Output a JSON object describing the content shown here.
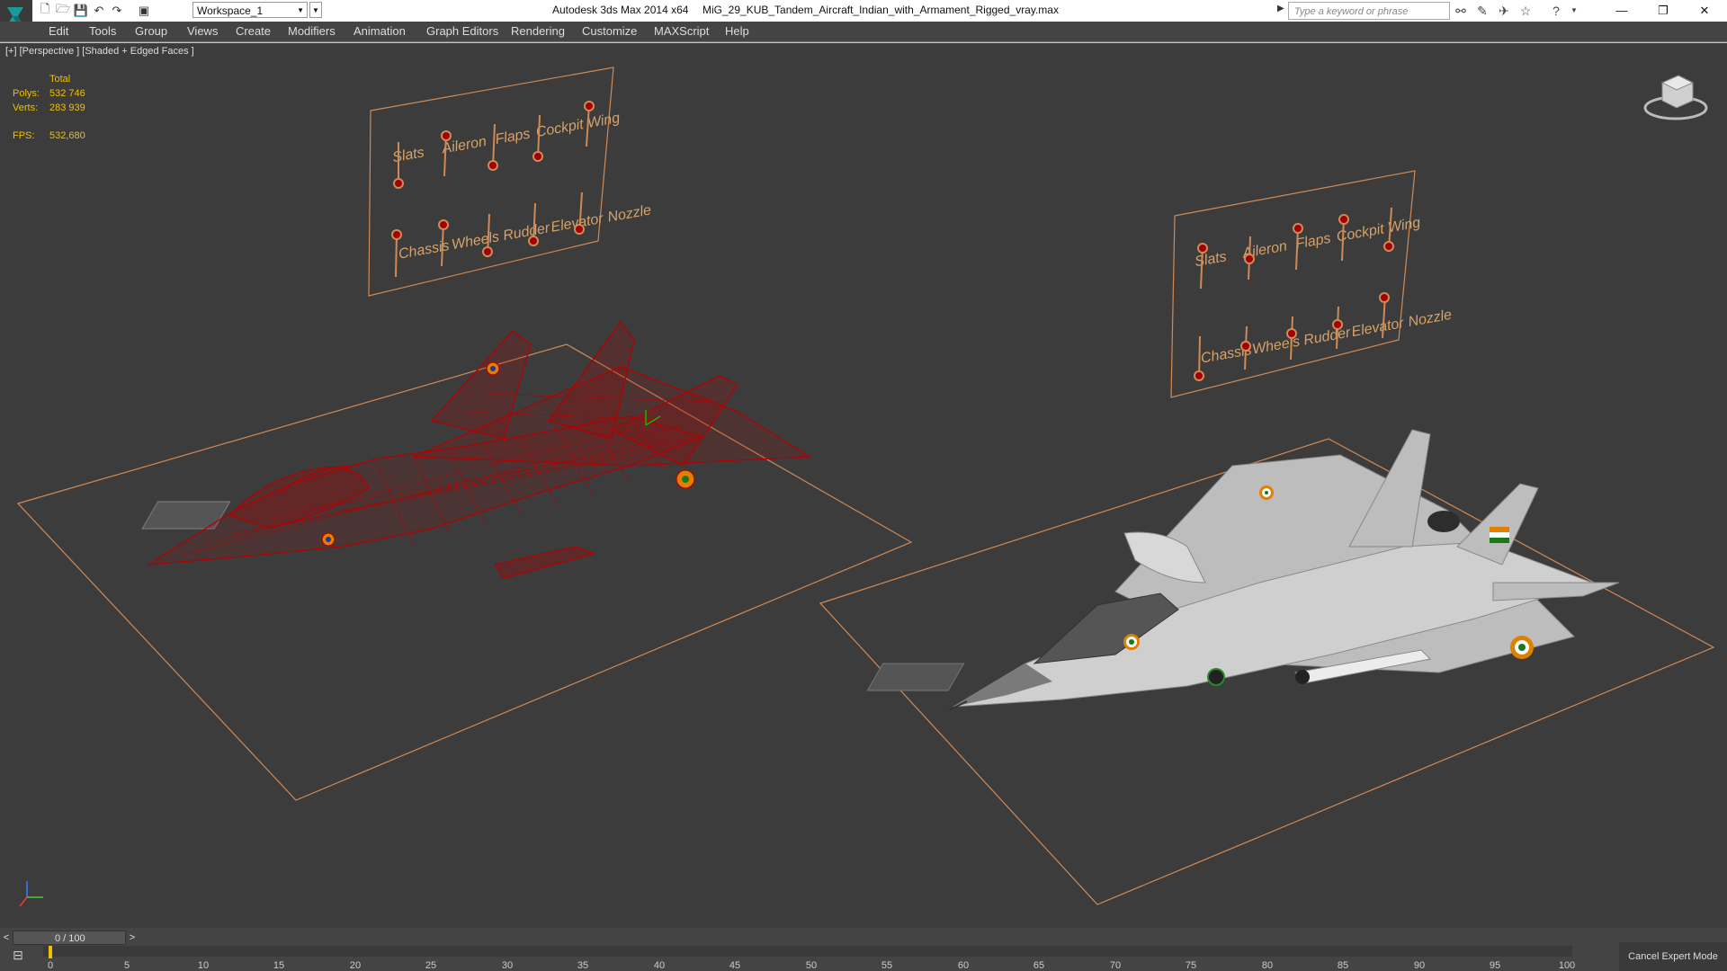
{
  "window": {
    "app_title": "Autodesk 3ds Max  2014 x64",
    "file_name": "MiG_29_KUB_Tandem_Aircraft_Indian_with_Armament_Rigged_vray.max",
    "workspace": "Workspace_1",
    "search_placeholder": "Type a keyword or phrase"
  },
  "menu": {
    "items": [
      "Edit",
      "Tools",
      "Group",
      "Views",
      "Create",
      "Modifiers",
      "Animation",
      "Graph Editors",
      "Rendering",
      "Customize",
      "MAXScript",
      "Help"
    ]
  },
  "viewport": {
    "label": "[+] [Perspective ] [Shaded + Edged Faces ]",
    "stats": {
      "header": "Total",
      "polys_label": "Polys:",
      "polys_value": "532 746",
      "verts_label": "Verts:",
      "verts_value": "283 939",
      "fps_label": "FPS:",
      "fps_value": "532,680"
    },
    "control_panel_left": {
      "top_row": [
        "Slats",
        "Aileron",
        "Flaps",
        "Cockpit",
        "Wing"
      ],
      "bottom_row": [
        "Chassis",
        "Wheels",
        "Rudder",
        "Elevator",
        "Nozzle"
      ]
    },
    "control_panel_right": {
      "top_row": [
        "Slats",
        "Aileron",
        "Flaps",
        "Cockpit",
        "Wing"
      ],
      "bottom_row": [
        "Chassis",
        "Wheels",
        "Rudder",
        "Elevator",
        "Nozzle"
      ]
    },
    "colors": {
      "wireframe": "#b30000",
      "grid_outline": "#d08a55",
      "panel_text": "#d5a36a",
      "stats_text": "#f0c000",
      "aircraft_body": "#c9c9c9"
    }
  },
  "timeline": {
    "frame_display": "0 / 100",
    "ticks": [
      "0",
      "5",
      "10",
      "15",
      "20",
      "25",
      "30",
      "35",
      "40",
      "45",
      "50",
      "55",
      "60",
      "65",
      "70",
      "75",
      "80",
      "85",
      "90",
      "95",
      "100"
    ],
    "cancel_expert": "Cancel Expert Mode"
  }
}
